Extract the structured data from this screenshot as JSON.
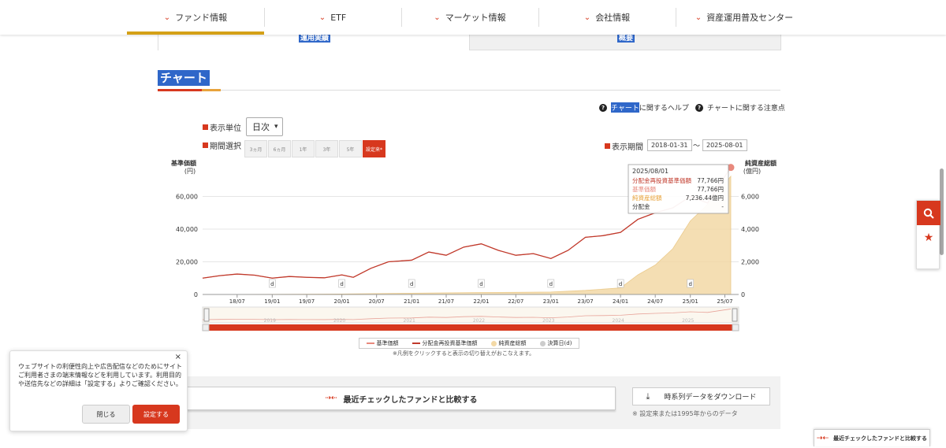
{
  "nav": {
    "items": [
      "ファンド情報",
      "ETF",
      "マーケット情報",
      "会社情報",
      "資産運用普及センター"
    ]
  },
  "tabs": {
    "left": "運用実績",
    "right": "概要"
  },
  "section": {
    "title": "チャート"
  },
  "help": {
    "chart_help_highlight": "チャート",
    "chart_help_rest": "に関するヘルプ",
    "chart_notes": "チャートに関する注意点"
  },
  "controls": {
    "unit_label": "表示単位",
    "unit_value": "日次",
    "period_label": "期間選択",
    "period_buttons": [
      "3ヵ月",
      "6ヵ月",
      "1年",
      "3年",
      "5年",
      "設定来*"
    ],
    "display_period_label": "表示期間",
    "date_from": "2018-01-31",
    "date_sep": "〜",
    "date_to": "2025-08-01"
  },
  "chart_data": {
    "type": "line",
    "left_axis_title": [
      "基準価額",
      "(円)"
    ],
    "right_axis_title": [
      "純資産総額",
      "(億円)"
    ],
    "left_ticks": [
      "60,000",
      "40,000",
      "20,000",
      "0"
    ],
    "right_ticks": [
      "6,000",
      "4,000",
      "2,000",
      "0"
    ],
    "ylim_left": [
      0,
      80000
    ],
    "ylim_right": [
      0,
      8000
    ],
    "x_ticks": [
      "18/07",
      "19/01",
      "19/07",
      "20/01",
      "20/07",
      "21/01",
      "21/07",
      "22/01",
      "22/07",
      "23/01",
      "23/07",
      "24/01",
      "24/07",
      "25/01",
      "25/07"
    ],
    "navigator_years": [
      "2019",
      "2020",
      "2021",
      "2022",
      "2023",
      "2024",
      "2025"
    ],
    "settlement_marker": "d",
    "series": [
      {
        "name": "分配金再投資基準価額",
        "color": "#c0392b",
        "x": [
          "2018-01",
          "2018-04",
          "2018-07",
          "2018-10",
          "2019-01",
          "2019-04",
          "2019-07",
          "2019-10",
          "2020-01",
          "2020-03",
          "2020-06",
          "2020-09",
          "2021-01",
          "2021-04",
          "2021-07",
          "2021-10",
          "2022-01",
          "2022-04",
          "2022-07",
          "2022-10",
          "2023-01",
          "2023-04",
          "2023-07",
          "2023-10",
          "2024-01",
          "2024-04",
          "2024-07",
          "2024-10",
          "2025-01",
          "2025-04",
          "2025-08"
        ],
        "values": [
          10000,
          11500,
          12500,
          11800,
          10000,
          11000,
          10500,
          10200,
          12000,
          10500,
          16000,
          20000,
          21000,
          26000,
          24000,
          29000,
          31000,
          27000,
          24000,
          25000,
          22000,
          27000,
          35000,
          36000,
          38000,
          46000,
          50000,
          53000,
          60000,
          56000,
          77766
        ]
      },
      {
        "name": "基準価額",
        "color": "#e8897d",
        "x": [
          "2018-01",
          "2018-04",
          "2018-07",
          "2018-10",
          "2019-01",
          "2019-04",
          "2019-07",
          "2019-10",
          "2020-01",
          "2020-03",
          "2020-06",
          "2020-09",
          "2021-01",
          "2021-04",
          "2021-07",
          "2021-10",
          "2022-01",
          "2022-04",
          "2022-07",
          "2022-10",
          "2023-01",
          "2023-04",
          "2023-07",
          "2023-10",
          "2024-01",
          "2024-04",
          "2024-07",
          "2024-10",
          "2025-01",
          "2025-04",
          "2025-08"
        ],
        "values": [
          10000,
          11500,
          12500,
          11800,
          10000,
          11000,
          10500,
          10200,
          12000,
          10500,
          16000,
          20000,
          21000,
          26000,
          24000,
          29000,
          31000,
          27000,
          24000,
          25000,
          22000,
          27000,
          35000,
          36000,
          38000,
          46000,
          50000,
          53000,
          60000,
          56000,
          77766
        ]
      },
      {
        "name": "純資産総額",
        "color": "#f3d9a6",
        "x": [
          "2018-01",
          "2019-01",
          "2020-01",
          "2021-01",
          "2022-01",
          "2022-07",
          "2023-01",
          "2023-07",
          "2024-01",
          "2024-04",
          "2024-07",
          "2024-10",
          "2025-01",
          "2025-04",
          "2025-08"
        ],
        "values": [
          0,
          10,
          30,
          80,
          120,
          130,
          150,
          250,
          400,
          1200,
          1800,
          2800,
          4500,
          5500,
          7236.44
        ]
      }
    ],
    "tooltip": {
      "date": "2025/08/01",
      "rows": [
        {
          "label": "分配金再投資基準価額",
          "value": "77,766円"
        },
        {
          "label": "基準価額",
          "value": "77,766円"
        },
        {
          "label": "純資産総額",
          "value": "7,236.44億円"
        },
        {
          "label": "分配金",
          "value": "-"
        }
      ]
    },
    "legend": [
      "基準価額",
      "分配金再投資基準価額",
      "純資産総額",
      "決算日(d)"
    ],
    "legend_note": "※凡例をクリックすると表示の切り替えがおこなえます。"
  },
  "compare": {
    "button_label": "最近チェックしたファンドと比較する",
    "download_label": "時系列データをダウンロード",
    "download_note": "※ 設定来または1995年からのデータ"
  },
  "cookie": {
    "text": "ウェブサイトの利便性向上や広告配信などのためにサイトご利用者さまの端末情報などを利用しています。利用目的や送信先などの詳細は「設定する」よりご確認ください。",
    "close_label": "閉じる",
    "settings_label": "設定する"
  },
  "floating": {
    "compare_label": "最近チェックしたファンドと比較する"
  },
  "colors": {
    "accent": "#d7381e",
    "gold": "#d4a017",
    "highlight": "#2f67c9"
  }
}
